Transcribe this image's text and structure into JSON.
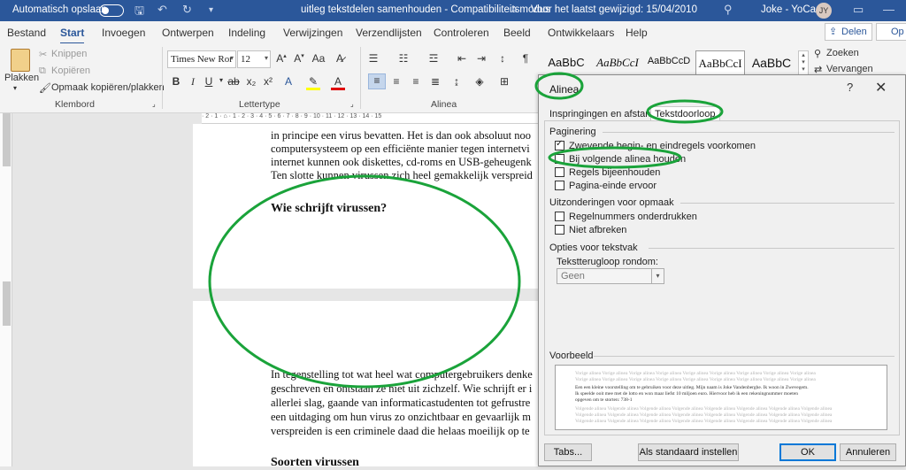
{
  "titlebar": {
    "autosave_label": "Automatisch opslaan",
    "doc_title": "uitleg tekstdelen samenhouden  -  Compatibiliteitsmodus",
    "saved_info": "Voor het laatst gewijzigd: 15/04/2010",
    "user_name": "Joke - YoCa",
    "user_initials": "JY"
  },
  "menu": {
    "tabs": [
      "Bestand",
      "Start",
      "Invoegen",
      "Ontwerpen",
      "Indeling",
      "Verwijzingen",
      "Verzendlijsten",
      "Controleren",
      "Beeld",
      "Ontwikkelaars",
      "Help"
    ],
    "active": "Start",
    "share_label": "Delen",
    "share2_label": "Op"
  },
  "ribbon": {
    "clipboard": {
      "paste_label": "Plakken",
      "cut_label": "Knippen",
      "copy_label": "Kopiëren",
      "format_painter_label": "Opmaak kopiëren/plakken",
      "group_label": "Klembord"
    },
    "font": {
      "font_name": "Times New Ror",
      "font_size": "12",
      "group_label": "Lettertype"
    },
    "paragraph": {
      "group_label": "Alinea"
    },
    "styles": [
      "AaBbC",
      "AaBbCcI",
      "AaBbCcD",
      "AaBbCcI",
      "AaBbC"
    ],
    "editing": {
      "find_label": "Zoeken",
      "replace_label": "Vervangen"
    }
  },
  "document": {
    "page1_lines": [
      "in principe een virus bevatten. Het is dan ook absoluut noo",
      "computersysteem op een efficiënte manier tegen internetvi",
      "internet kunnen ook diskettes, cd-roms en USB-geheugenk",
      "Ten slotte kunnen virussen zich heel gemakkelijk verspreid"
    ],
    "heading1": "Wie schrijft virussen?",
    "page2_lines": [
      "In tegenstelling tot wat heel wat computergebruikers denke",
      "geschreven en ontstaan ze niet uit zichzelf. Wie schrijft er i",
      "allerlei slag, gaande van informaticastudenten tot gefrustre",
      "een uitdaging om hun virus zo onzichtbaar en gevaarlijk m",
      "verspreiden is een criminele daad die helaas moeilijk op te"
    ],
    "heading2": "Soorten virussen"
  },
  "dialog": {
    "title": "Alinea",
    "help": "?",
    "close": "✕",
    "tabs": [
      "Inspringingen en afstand",
      "Tekstdoorloop"
    ],
    "active_tab": "Tekstdoorloop",
    "pagination": {
      "label": "Paginering",
      "options": [
        {
          "label": "Zwevende begin- en eindregels voorkomen",
          "checked": true
        },
        {
          "label": "Bij volgende alinea houden",
          "checked": false
        },
        {
          "label": "Regels bijeenhouden",
          "checked": false
        },
        {
          "label": "Pagina-einde ervoor",
          "checked": false
        }
      ]
    },
    "formatting_exceptions": {
      "label": "Uitzonderingen voor opmaak",
      "options": [
        {
          "label": "Regelnummers onderdrukken",
          "checked": false
        },
        {
          "label": "Niet afbreken",
          "checked": false
        }
      ]
    },
    "textbox_options": {
      "label": "Opties voor tekstvak",
      "wrap_label": "Tekstterugloop rondom:",
      "wrap_value": "Geen"
    },
    "preview": {
      "label": "Voorbeeld",
      "prev_text": "Vorige alinea Vorige alinea Vorige alinea Vorige alinea Vorige alinea Vorige alinea Vorige alinea Vorige alinea Vorige alinea",
      "sample_lines": [
        "Een een kleine voorstelling om te gebruiken voor deze uitleg. Mijn naam is Joke Vandenberghe. Ik woon in Zwevegem.",
        "Ik speelde ooit mee met de lotto en won maar liefst 10 miljoen euro. Hiervoor heb ik een rekeningnummer moeten",
        "opgeven om te storten: 738-1"
      ],
      "next_text": "Volgende alinea Volgende alinea Volgende alinea Volgende alinea Volgende alinea Volgende alinea Volgende alinea Volgende alinea"
    },
    "buttons": {
      "tabs": "Tabs...",
      "default": "Als standaard instellen",
      "ok": "OK",
      "cancel": "Annuleren"
    }
  },
  "colors": {
    "titlebar": "#2b579a",
    "annotation": "#1aa33a"
  }
}
